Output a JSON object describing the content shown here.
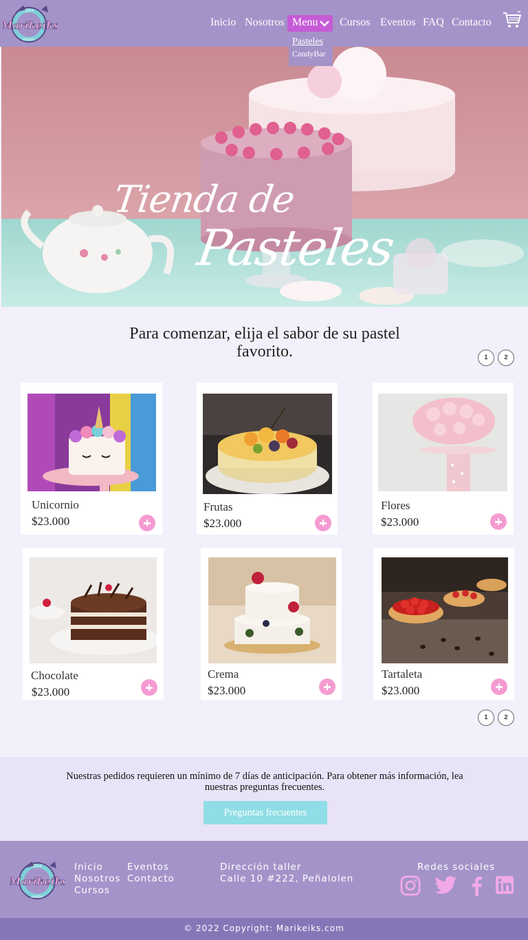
{
  "brand": {
    "logo_text": "Marikeiks",
    "logo_year": "2014",
    "logo_sub": "BAKERY"
  },
  "nav": {
    "items": [
      "Inicio",
      "Nosotros",
      "Menu",
      "Cursos",
      "Eventos",
      "FAQ",
      "Contacto"
    ],
    "dropdown": [
      "Pasteles",
      "CandyBar"
    ]
  },
  "hero": {
    "title_line1": "Tienda de",
    "title_line2": "Pasteles"
  },
  "section": {
    "title": "Para comenzar, elija el sabor de su pastel favorito."
  },
  "pagination": [
    "1",
    "2"
  ],
  "products": [
    {
      "name": "Unicornio",
      "price": "$23.000"
    },
    {
      "name": "Frutas",
      "price": "$23.000"
    },
    {
      "name": "Flores",
      "price": "$23.000"
    },
    {
      "name": "Chocolate",
      "price": "$23.000"
    },
    {
      "name": "Crema",
      "price": "$23.000"
    },
    {
      "name": "Tartaleta",
      "price": "$23.000"
    }
  ],
  "info": {
    "text": "Nuestras pedidos requieren un mínimo de 7 días de anticipación. Para obtener más información, lea nuestras preguntas frecuentes.",
    "button": "Preguntas frecuentes"
  },
  "footer": {
    "links_col1": [
      "Inicio",
      "Nosotros",
      "Cursos"
    ],
    "links_col2": [
      "Eventos",
      "Contacto"
    ],
    "address_title": "Dirección taller",
    "address": "Calle 10 #222, Peñalolen",
    "social_title": "Redes sociales",
    "social": [
      "instagram-icon",
      "twitter-icon",
      "facebook-icon",
      "linkedin-icon"
    ],
    "copyright": "© 2022 Copyright: Marikeiks.com"
  },
  "colors": {
    "nav": "#a493c9",
    "menu_active": "#c65bd6",
    "add_button": "#f59bd2",
    "faq_button": "#8fdde6",
    "social": "#f0a8e6"
  }
}
